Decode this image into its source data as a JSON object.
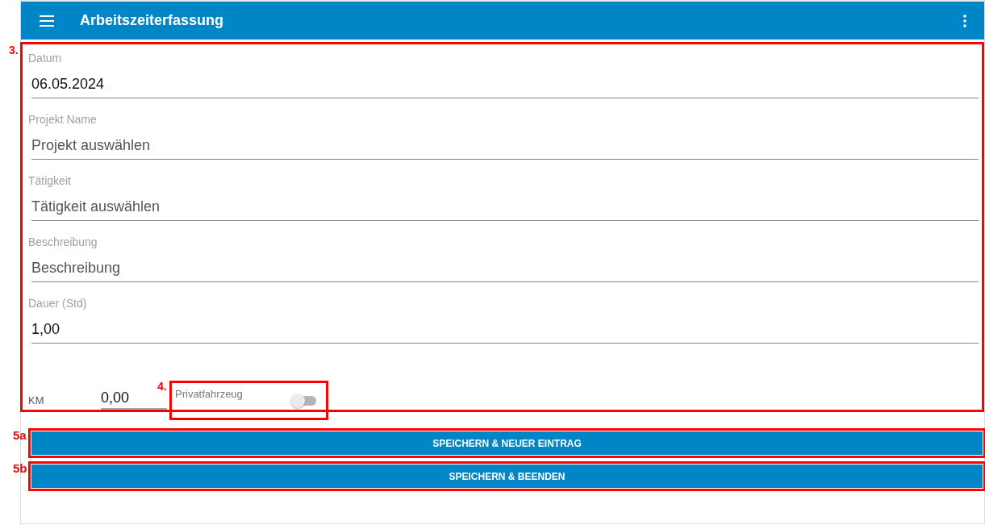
{
  "app_bar": {
    "title": "Arbeitszeiterfassung"
  },
  "form": {
    "annotation": "3.",
    "fields": [
      {
        "label": "Datum",
        "value": "06.05.2024"
      },
      {
        "label": "Projekt Name",
        "placeholder": "Projekt auswählen"
      },
      {
        "label": "Tätigkeit",
        "placeholder": "Tätigkeit auswählen"
      },
      {
        "label": "Beschreibung",
        "placeholder": "Beschreibung"
      },
      {
        "label": "Dauer (Std)",
        "value": "1,00"
      }
    ],
    "km": {
      "label": "KM",
      "value": "0,00"
    },
    "private_vehicle": {
      "annotation": "4.",
      "label": "Privatfahrzeug",
      "on": false
    }
  },
  "buttons": [
    {
      "annotation": "5a",
      "label": "SPEICHERN & NEUER EINTRAG"
    },
    {
      "annotation": "5b",
      "label": "SPEICHERN & BEENDEN"
    }
  ]
}
